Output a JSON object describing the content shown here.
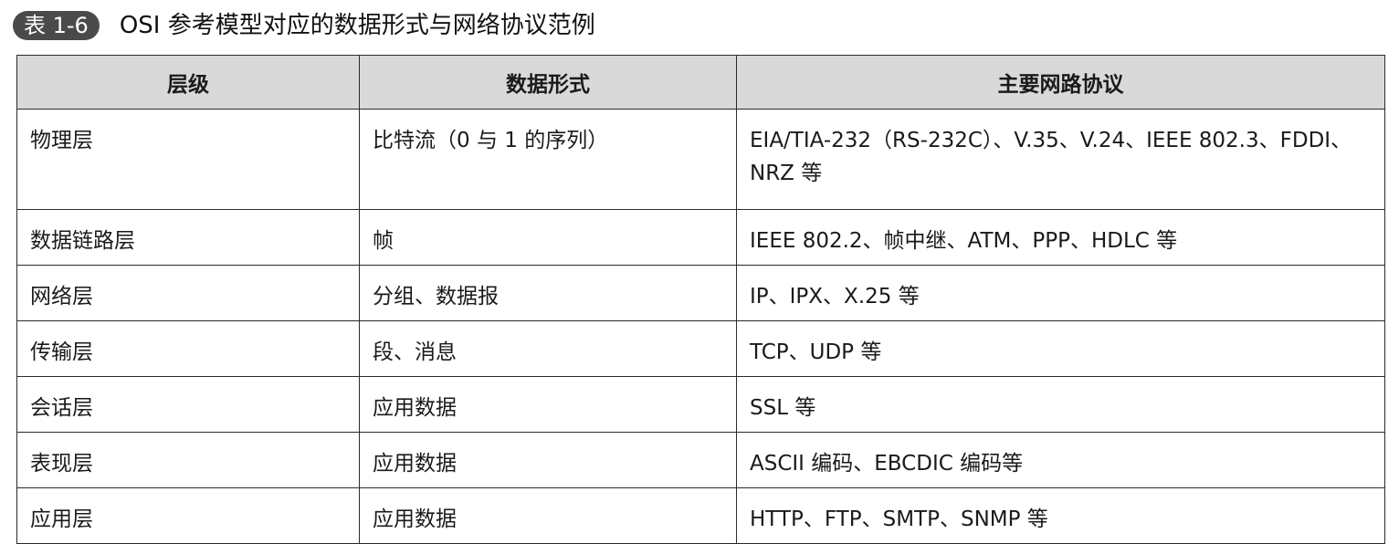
{
  "caption": {
    "badge": "表 1-6",
    "title": "OSI 参考模型对应的数据形式与网络协议范例"
  },
  "table": {
    "headers": [
      "层级",
      "数据形式",
      "主要网路协议"
    ],
    "rows": [
      [
        "物理层",
        "比特流（0 与 1 的序列）",
        "EIA/TIA-232（RS-232C）、V.35、V.24、IEEE 802.3、FDDI、NRZ 等"
      ],
      [
        "数据链路层",
        "帧",
        "IEEE 802.2、帧中继、ATM、PPP、HDLC 等"
      ],
      [
        "网络层",
        "分组、数据报",
        "IP、IPX、X.25 等"
      ],
      [
        "传输层",
        "段、消息",
        "TCP、UDP 等"
      ],
      [
        "会话层",
        "应用数据",
        "SSL 等"
      ],
      [
        "表现层",
        "应用数据",
        "ASCII 编码、EBCDIC 编码等"
      ],
      [
        "应用层",
        "应用数据",
        "HTTP、FTP、SMTP、SNMP 等"
      ]
    ]
  }
}
